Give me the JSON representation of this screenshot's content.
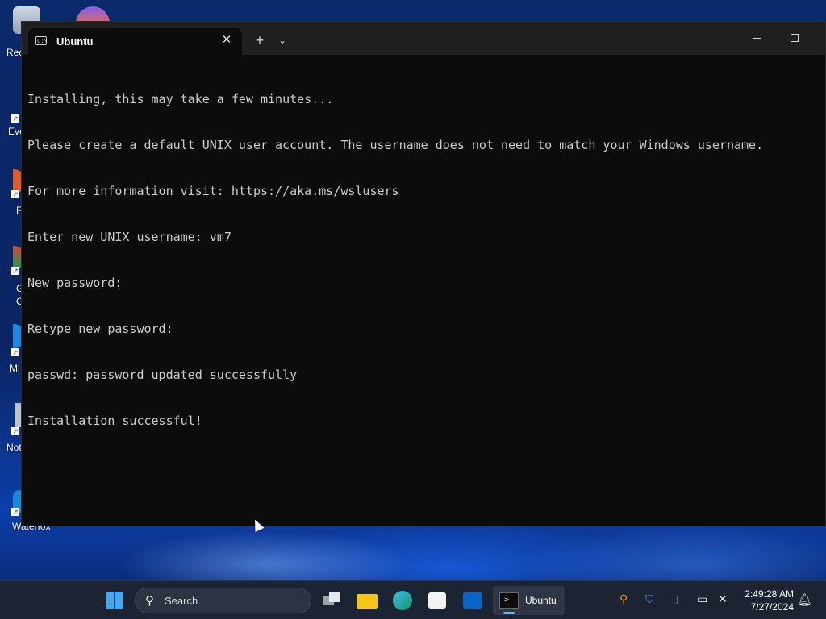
{
  "desktop": {
    "icons": [
      {
        "label": "Rec",
        "icon": "recycle-bin-icon"
      },
      {
        "label": "Eve",
        "icon": "evernote-icon"
      },
      {
        "label": "F",
        "icon": "firefox-icon"
      },
      {
        "label": "G",
        "label2": "C",
        "icon": "chrome-icon"
      },
      {
        "label": "Mi",
        "icon": "edge-icon"
      },
      {
        "label": "Not",
        "icon": "notepad-icon"
      },
      {
        "label": "Waterfox",
        "icon": "waterfox-icon"
      }
    ]
  },
  "terminal": {
    "tab_title": "Ubuntu",
    "tab_close": "✕",
    "new_tab": "+",
    "dropdown": "⌄",
    "lines": [
      "Installing, this may take a few minutes...",
      "Please create a default UNIX user account. The username does not need to match your Windows username.",
      "For more information visit: https://aka.ms/wslusers",
      "Enter new UNIX username: vm7",
      "New password:",
      "Retype new password:",
      "passwd: password updated successfully",
      "Installation successful!"
    ]
  },
  "taskbar": {
    "search_placeholder": "Search",
    "active_app": "Ubuntu",
    "time": "2:49:28 AM",
    "date": "7/27/2024"
  },
  "colors": {
    "terminal_bg": "#0c0c0c",
    "terminal_text": "#cccccc",
    "titlebar": "#1f1f1f",
    "taskbar": "#1c2433",
    "accent": "#3fa9f5"
  }
}
